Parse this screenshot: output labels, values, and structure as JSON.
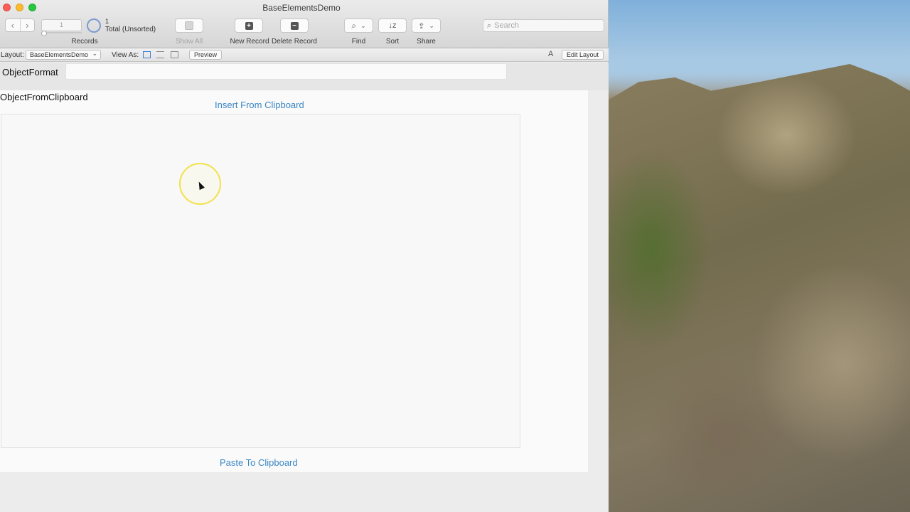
{
  "window": {
    "title": "BaseElementsDemo"
  },
  "toolbar": {
    "record_field_value": "1",
    "record_count": "1",
    "record_total": "Total (Unsorted)",
    "records_label": "Records",
    "show_all_label": "Show All",
    "new_record_label": "New Record",
    "delete_record_label": "Delete Record",
    "find_label": "Find",
    "sort_label": "Sort",
    "share_label": "Share",
    "search_placeholder": "Search"
  },
  "layout_bar": {
    "layout_label": "Layout:",
    "layout_value": "BaseElementsDemo",
    "view_as_label": "View As:",
    "preview_label": "Preview",
    "font_icon_text": "A",
    "edit_layout_label": "Edit Layout"
  },
  "form": {
    "object_format_label": "ObjectFormat",
    "object_format_value": "",
    "object_from_clipboard_label": "ObjectFromClipboard",
    "insert_button": "Insert From Clipboard",
    "paste_button": "Paste To Clipboard"
  },
  "colors": {
    "link": "#3a86c4",
    "cursor_highlight": "#f2e14a"
  }
}
